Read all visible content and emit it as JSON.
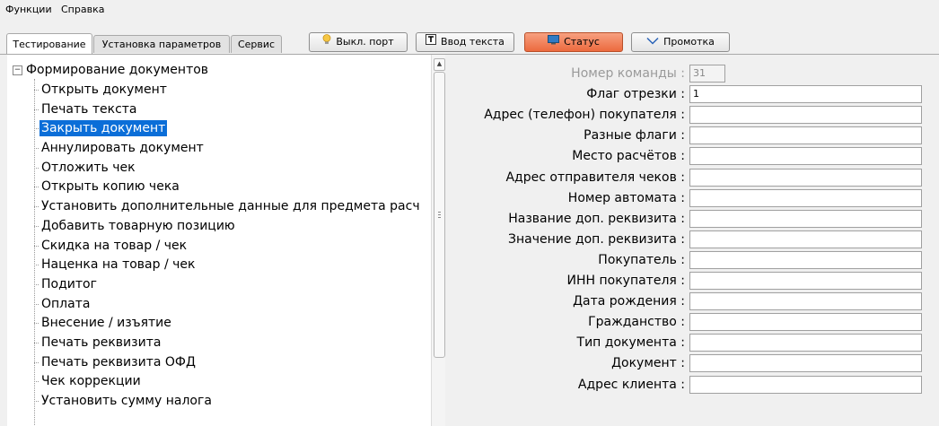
{
  "menu": [
    "Функции",
    "Справка"
  ],
  "tabs": [
    {
      "label": "Тестирование",
      "active": true
    },
    {
      "label": "Установка параметров",
      "active": false
    },
    {
      "label": "Сервис",
      "active": false
    }
  ],
  "toolbar": {
    "port_button": "Выкл. порт",
    "text_input_button": "Ввод текста",
    "status_button": "Статус",
    "feed_button": "Промотка"
  },
  "tree": {
    "root": "Формирование документов",
    "items": [
      "Открыть документ",
      "Печать текста",
      "Закрыть документ",
      "Аннулировать документ",
      "Отложить чек",
      "Открыть копию чека",
      "Установить дополнительные данные для предмета расч",
      "Добавить товарную позицию",
      "Скидка на товар / чек",
      "Наценка на товар / чек",
      "Подитог",
      "Оплата",
      "Внесение / изъятие",
      "Печать реквизита",
      "Печать реквизита ОФД",
      "Чек коррекции",
      "Установить сумму налога"
    ],
    "selected_index": 2
  },
  "form": {
    "fields": [
      {
        "label": "Номер команды :",
        "value": "31",
        "disabled": true
      },
      {
        "label": "Флаг отрезки :",
        "value": "1"
      },
      {
        "label": "Адрес (телефон) покупателя :",
        "value": ""
      },
      {
        "label": "Разные флаги :",
        "value": ""
      },
      {
        "label": "Место расчётов :",
        "value": ""
      },
      {
        "label": "Адрес отправителя чеков :",
        "value": ""
      },
      {
        "label": "Номер автомата :",
        "value": ""
      },
      {
        "label": "Название доп. реквизита :",
        "value": ""
      },
      {
        "label": "Значение доп. реквизита :",
        "value": ""
      },
      {
        "label": "Покупатель :",
        "value": ""
      },
      {
        "label": "ИНН покупателя :",
        "value": ""
      },
      {
        "label": "Дата рождения :",
        "value": ""
      },
      {
        "label": "Гражданство :",
        "value": ""
      },
      {
        "label": "Тип документа :",
        "value": ""
      },
      {
        "label": "Документ :",
        "value": ""
      },
      {
        "label": "Адрес клиента :",
        "value": ""
      }
    ]
  },
  "colors": {
    "selection": "#0b6ed8",
    "status_button": "#ec6a3e"
  },
  "icons": {
    "port": "lightbulb-icon",
    "text": "text-t-icon",
    "status": "monitor-icon",
    "feed": "chevron-down-icon"
  }
}
